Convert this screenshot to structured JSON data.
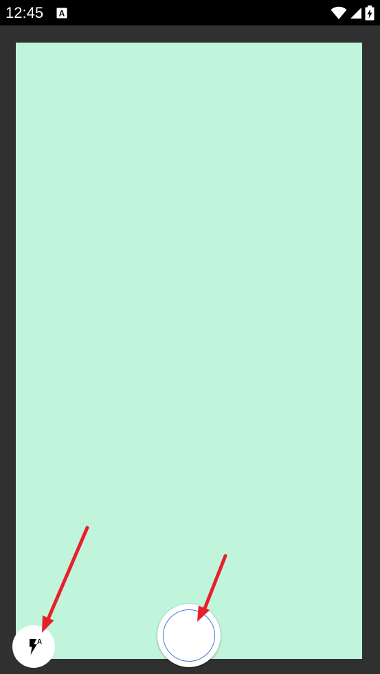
{
  "status_bar": {
    "time": "12:45",
    "icons": [
      "notification-a-icon",
      "wifi-icon",
      "signal-icon",
      "battery-charging-icon"
    ]
  },
  "camera": {
    "viewfinder_color": "#c0f5dc",
    "flash_button": {
      "icon": "flash-auto-icon",
      "icon_label": "A"
    },
    "shutter_button": {
      "ring_color": "#3b78d8"
    }
  },
  "annotations": {
    "arrow_color": "#e8202a",
    "targets": [
      "flash-button",
      "shutter-button"
    ]
  }
}
